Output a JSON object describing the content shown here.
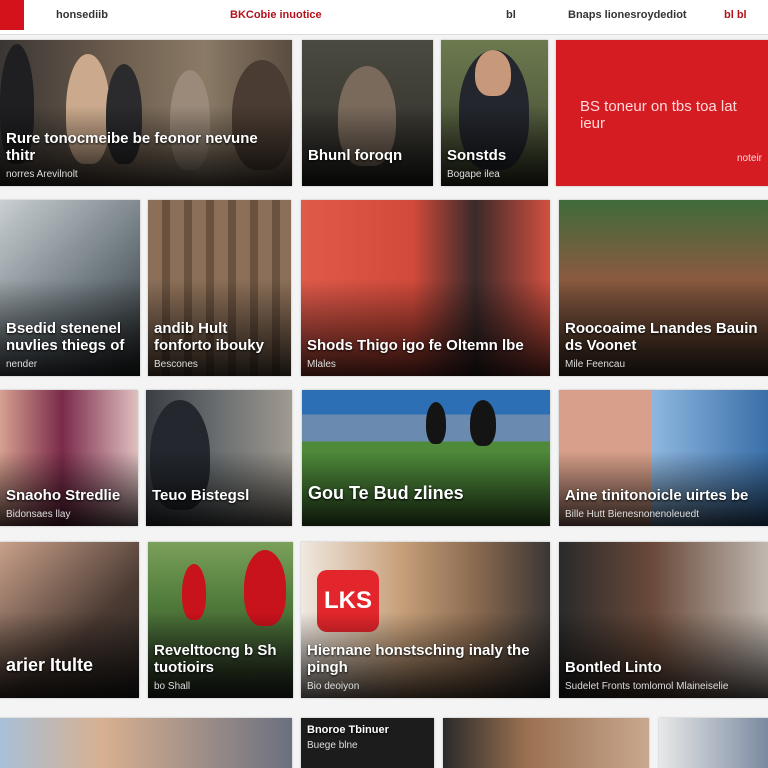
{
  "header": {
    "left_label": "honsediib",
    "brand": "BKCobie inuotice",
    "icon_label": "bl",
    "user_label": "Bnaps lionesroydediot",
    "right_label": "bl bl"
  },
  "row1": [
    {
      "headline": "Rure tonocmeibe be feonor nevune thitr",
      "sub": "norres Arevilnolt"
    },
    {
      "headline": "Bhunl foroqn",
      "sub": ""
    },
    {
      "headline": "Sonstds",
      "sub": "Bogape ilea"
    },
    {
      "headline": "BS toneur on tbs toa lat ieur",
      "sub": "noteir"
    }
  ],
  "row2": [
    {
      "headline": "Bsedid stenenel nuvlies thiegs of",
      "sub": "nender"
    },
    {
      "headline": "andib Hult fonforto ibouky",
      "sub": "Bescones"
    },
    {
      "headline": "Shods Thigo igo fe Oltemn lbe",
      "sub": "Mlales"
    },
    {
      "headline": "Roocoaime Lnandes Bauin ds Voonet",
      "sub": "Mile Feencau"
    }
  ],
  "row3": [
    {
      "headline": "Snaoho Stredlie",
      "sub": "Bidonsaes llay"
    },
    {
      "headline": "Teuo Bistegsl",
      "sub": ""
    },
    {
      "headline": "Gou Te Bud zlines",
      "sub": ""
    },
    {
      "headline": "Aine tinitonoicle uirtes be",
      "sub": "Bille Hutt  Bienesnonenoleuedt"
    }
  ],
  "row4": [
    {
      "headline": "arier Itulte",
      "sub": ""
    },
    {
      "headline": "Revelttocng b Sh tuotioirs",
      "sub": "bo Shall"
    },
    {
      "headline": "Hiernane honstsching inaly the pingh",
      "sub": "Bio deoiyon",
      "badge": "LKS"
    },
    {
      "headline": "Bontled Linto",
      "sub": "Sudelet Fronts tomlomol   Mlaineiselie"
    }
  ],
  "row5": [
    {
      "headline": "",
      "sub": ""
    },
    {
      "headline": "Bnoroe Tbinuer",
      "sub": "Buege blne"
    },
    {
      "headline": "",
      "sub": ""
    },
    {
      "headline": "",
      "sub": ""
    }
  ],
  "colors": {
    "brand_red": "#d3121b",
    "badge_red": "#e3262b",
    "accent_blue": "#2c6fb4"
  }
}
